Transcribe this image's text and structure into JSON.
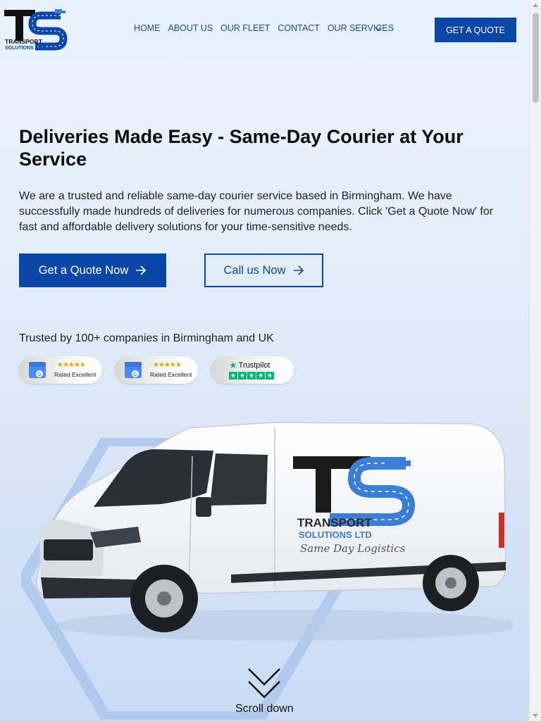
{
  "header": {
    "logo": {
      "letters": "TS",
      "line1": "TRANSPORT",
      "line2": "SOLUTIONS LTD"
    },
    "nav": {
      "items": [
        {
          "label": "HOME"
        },
        {
          "label": "ABOUT US"
        },
        {
          "label": "OUR FLEET"
        },
        {
          "label": "CONTACT"
        },
        {
          "label": "OUR SERVICES"
        }
      ],
      "services_dropdown_icon": "chevron-down-icon"
    },
    "quote_button": "GET A QUOTE"
  },
  "hero": {
    "title": "Deliveries Made Easy - Same-Day Courier at Your Service",
    "text": "We are a trusted and reliable same-day courier service based in Birmingham. We have successfully made hundreds of deliveries for numerous companies. Click 'Get a Quote Now' for fast and affordable delivery solutions for your time-sensitive needs.",
    "primary_button": "Get a Quote Now",
    "secondary_button": "Call us Now",
    "trusted_text": "Trusted by 100+ companies in Birmingham and UK",
    "badges": [
      {
        "type": "google",
        "stars": "★★★★★",
        "label": "Rated Excellent"
      },
      {
        "type": "google",
        "stars": "★★★★★",
        "label": "Rated Excellent"
      },
      {
        "type": "trustpilot",
        "brand": "Trustpilot",
        "stars": 5
      }
    ]
  },
  "van_graphic": {
    "brand_letters": "TS",
    "line1": "TRANSPORT",
    "line2": "SOLUTIONS LTD",
    "tagline": "Same Day Logistics"
  },
  "scroll_down": {
    "icon": "double-chevron-down-icon",
    "label": "Scroll down"
  },
  "colors": {
    "brand_blue": "#0b47a8",
    "nav_text": "#1b4d9e",
    "logo_light_blue": "#3a7fd5",
    "trustpilot_green": "#00b67a"
  }
}
